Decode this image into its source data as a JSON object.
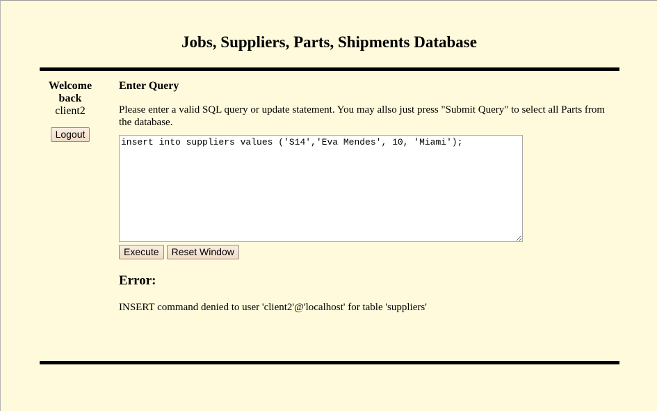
{
  "header": {
    "title": "Jobs, Suppliers, Parts, Shipments Database"
  },
  "sidebar": {
    "welcome": "Welcome back",
    "username": "client2",
    "logout_label": "Logout"
  },
  "main": {
    "heading": "Enter Query",
    "instructions": "Please enter a valid SQL query or update statement. You may allso just press \"Submit Query\" to select all Parts from the database.",
    "query_value": "insert into suppliers values ('S14','Eva Mendes', 10, 'Miami');",
    "execute_label": "Execute",
    "reset_label": "Reset Window",
    "error_heading": "Error:",
    "error_message": "INSERT command denied to user 'client2'@'localhost' for table 'suppliers'"
  }
}
